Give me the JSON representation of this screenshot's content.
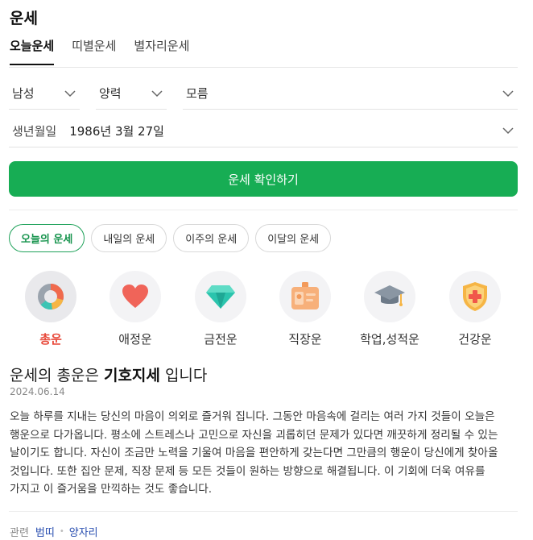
{
  "header": {
    "title": "운세"
  },
  "tabs": [
    {
      "label": "오늘운세",
      "active": true
    },
    {
      "label": "띠별운세",
      "active": false
    },
    {
      "label": "별자리운세",
      "active": false
    }
  ],
  "form": {
    "gender": "남성",
    "calendar": "양력",
    "birth_time": "모름",
    "birth_label": "생년월일",
    "birth_value": "1986년 3월 27일",
    "submit_label": "운세 확인하기"
  },
  "period_pills": [
    {
      "label": "오늘의 운세",
      "active": true
    },
    {
      "label": "내일의 운세",
      "active": false
    },
    {
      "label": "이주의 운세",
      "active": false
    },
    {
      "label": "이달의 운세",
      "active": false
    }
  ],
  "categories": [
    {
      "label": "총운",
      "icon": "donut-chart-icon",
      "active": true
    },
    {
      "label": "애정운",
      "icon": "heart-icon",
      "active": false
    },
    {
      "label": "금전운",
      "icon": "diamond-icon",
      "active": false
    },
    {
      "label": "직장운",
      "icon": "id-badge-icon",
      "active": false
    },
    {
      "label": "학업,성적운",
      "icon": "graduation-cap-icon",
      "active": false
    },
    {
      "label": "건강운",
      "icon": "health-shield-icon",
      "active": false
    }
  ],
  "result": {
    "title_prefix": "운세의 총운은",
    "title_highlight": "기호지세",
    "title_suffix": "입니다",
    "date": "2024.06.14",
    "body": "오늘 하루를 지내는 당신의 마음이 의외로 즐거워 집니다. 그동안 마음속에 걸리는 여러 가지 것들이 오늘은 행운으로 다가옵니다. 평소에 스트레스나 고민으로 자신을 괴롭히던 문제가 있다면 깨끗하게 정리될 수 있는 날이기도 합니다. 자신이 조금만 노력을 기울여 마음을 편안하게 갖는다면 그만큼의 행운이 당신에게 찾아올 것입니다. 또한 집안 문제, 직장 문제 등 모든 것들이 원하는 방향으로 해결됩니다. 이 기회에 더욱 여유를 가지고 이 즐거움을 만끽하는 것도 좋습니다."
  },
  "related": {
    "label": "관련",
    "links": [
      "범띠",
      "양자리"
    ]
  },
  "colors": {
    "accent_green": "#17ad54",
    "active_category_red": "#e84a3b",
    "link_blue": "#2a4fb0"
  }
}
